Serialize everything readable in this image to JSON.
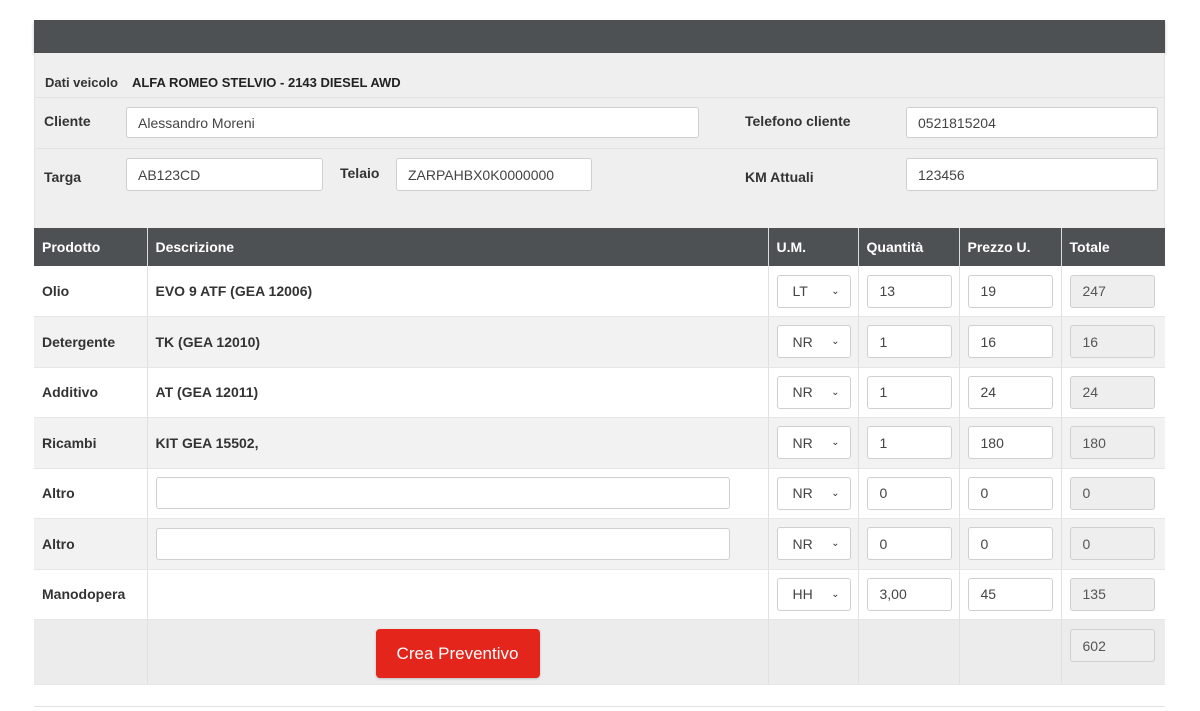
{
  "vehicle": {
    "label": "Dati veicolo",
    "value": "ALFA ROMEO STELVIO - 2143 DIESEL AWD"
  },
  "client": {
    "cliente_label": "Cliente",
    "cliente_value": "Alessandro Moreni",
    "telefono_label": "Telefono cliente",
    "telefono_value": "0521815204",
    "targa_label": "Targa",
    "targa_value": "AB123CD",
    "telaio_label": "Telaio",
    "telaio_value": "ZARPAHBX0K0000000",
    "km_label": "KM Attuali",
    "km_value": "123456"
  },
  "table": {
    "headers": [
      "Prodotto",
      "Descrizione",
      "U.M.",
      "Quantità",
      "Prezzo U.",
      "Totale"
    ],
    "rows": [
      {
        "prodotto": "Olio",
        "descrizione": "EVO 9 ATF (GEA 12006)",
        "um": "LT",
        "quantita": "13",
        "prezzo": "19",
        "totale": "247"
      },
      {
        "prodotto": "Detergente",
        "descrizione": "TK (GEA 12010)",
        "um": "NR",
        "quantita": "1",
        "prezzo": "16",
        "totale": "16"
      },
      {
        "prodotto": "Additivo",
        "descrizione": "AT (GEA 12011)",
        "um": "NR",
        "quantita": "1",
        "prezzo": "24",
        "totale": "24"
      },
      {
        "prodotto": "Ricambi",
        "descrizione": "KIT GEA 15502,",
        "um": "NR",
        "quantita": "1",
        "prezzo": "180",
        "totale": "180"
      },
      {
        "prodotto": "Altro",
        "descrizione": "",
        "um": "NR",
        "quantita": "0",
        "prezzo": "0",
        "totale": "0"
      },
      {
        "prodotto": "Altro",
        "descrizione": "",
        "um": "NR",
        "quantita": "0",
        "prezzo": "0",
        "totale": "0"
      },
      {
        "prodotto": "Manodopera",
        "descrizione": "",
        "um": "HH",
        "quantita": "3,00",
        "prezzo": "45",
        "totale": "135"
      }
    ],
    "grand_total": "602",
    "create_button": "Crea Preventivo"
  },
  "colors": {
    "header_bar": "#4e5154",
    "button_red": "#e3251c"
  }
}
